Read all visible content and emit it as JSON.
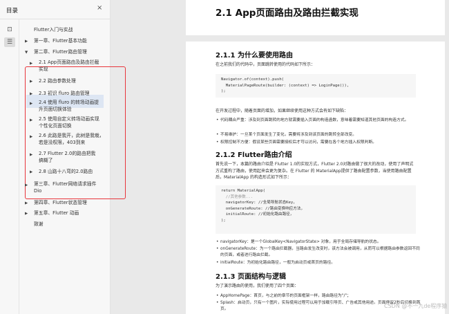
{
  "sidebar": {
    "title": "目录",
    "close_icon": "×",
    "rail": [
      {
        "name": "thumbnail-view-icon",
        "glyph": "⊡"
      },
      {
        "name": "outline-list-icon",
        "glyph": "☰"
      }
    ],
    "toc": [
      {
        "label": "Flutter入门与实战"
      },
      {
        "label": "第一章、Flutter基本功能"
      },
      {
        "label": "第二章、Flutter路由管理"
      },
      {
        "label": "2.1 App页面路由及路由拦截实现"
      },
      {
        "label": "2.2 路由参数处理"
      },
      {
        "label": "2.3 初识 fluro 路由管理"
      },
      {
        "label": "2.4 使用 fluro 的转场动画提升页面切换体验"
      },
      {
        "label": "2.5 使用自定义转场动画实现个性化页面切换"
      },
      {
        "label": "2.6 此路是我开，此树是我栽，若是没权限，403到来"
      },
      {
        "label": "2.7 Flutter 2.0的路由把我搞糊了"
      },
      {
        "label": "2.8 山路十八弯的2.0路由"
      },
      {
        "label": "第三章、Flutter网络请求插件Dio"
      },
      {
        "label": "第四章、Flutter状态管理"
      },
      {
        "label": "第五章、Flutter 动画"
      },
      {
        "label": "致谢"
      }
    ]
  },
  "document": {
    "h1": "2.1 App页面路由及路由拦截实现",
    "s1_title": "2.1.1 为什么要使用路由",
    "s1_intro": "在之前我们的代码中，页面跳转使用的代码如下所示：",
    "s1_code": [
      "Navigator.of(context).push(",
      "  MaterialPageRoute(builder: (context) => LoginPage()),",
      ");"
    ],
    "s1_after": "在开发过程中，随着页面的增加，如果继续使用这种方式会有如下缺陷：",
    "s1_bullets": [
      "代码耦合严重：涉及到页面跳转的地方就需要插入页面的构造函数，意味着需要知道其他页面的构造方式。",
      "不易维护：一旦某个页面发生了变化，需要将涉及到该页面的跳转全部改变。",
      "权限控制不方便：假设某些页面需要授权后才可以访问，需要在各个地方插入权限判断。"
    ],
    "s2_title": "2.1.2 Flutter路由介绍",
    "s2_para": "首先说一下，本篇的路由介绍是 Flutter 1.0的实现方式，Flutter 2.0对路由做了很大的改动，使用了声明式方式重构了路由，使用起来会更为复杂。在 Flutter 的 MaterialApp提供了路由配置参数，当使用路由配置后，MaterialApp 的构造形式如下所示：",
    "s2_code": [
      "return MaterialApp(",
      "  //其他参数...",
      "  navigatorKey: //全局导航状态Key，",
      "  onGenerateRoute: //路由变换响应方法，",
      "  initialRoute: //初始化路由路径，",
      ");"
    ],
    "s2_bullets": [
      "navigatorKey：是一个GlobalKey<NavigatorState> 对象，用于全局存储导航的状态。",
      "onGenerateRoute：为一个路由拦截器，当路由发生改变时，该方法会被调用，从而可以根据路由参数返回不同的页面，或者进行路由拦截。",
      "initialRoute：为初始化路由路径，一般为启动页或首页的路径。"
    ],
    "s3_title": "2.1.3 页面结构与逻辑",
    "s3_intro": "为了演示路由的使用，我们使用了四个页面：",
    "s3_bullets": [
      "AppHomePage：首页，与之前的章节的页面框架一样，路由路径为\"/\"；",
      "Splash：启动页，只有一个图片，实际使用过程可以用于加载引导页、广告或其他用途。页面停留2秒后切换到首页。"
    ],
    "watermark": "CSDN @不一九de程序猿"
  }
}
